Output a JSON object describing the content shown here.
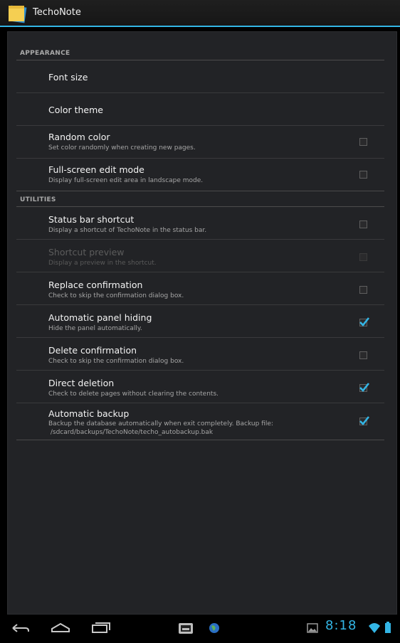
{
  "app": {
    "title": "TechoNote"
  },
  "sections": {
    "appearance": "APPEARANCE",
    "utilities": "UTILITIES"
  },
  "prefs": {
    "font_size": {
      "title": "Font size"
    },
    "color_theme": {
      "title": "Color theme"
    },
    "random_color": {
      "title": "Random color",
      "summary": "Set color randomly when creating new pages.",
      "checked": false
    },
    "fullscreen": {
      "title": "Full-screen edit mode",
      "summary": "Display full-screen edit area in landscape mode.",
      "checked": false
    },
    "status_bar_shortcut": {
      "title": "Status bar shortcut",
      "summary": "Display a shortcut of TechoNote in the status bar.",
      "checked": false
    },
    "shortcut_preview": {
      "title": "Shortcut preview",
      "summary": "Display a preview in the shortcut.",
      "checked": false,
      "enabled": false
    },
    "replace_confirmation": {
      "title": "Replace confirmation",
      "summary": "Check to skip the confirmation dialog box.",
      "checked": false
    },
    "auto_panel_hiding": {
      "title": "Automatic panel hiding",
      "summary": "Hide the panel automatically.",
      "checked": true
    },
    "delete_confirmation": {
      "title": "Delete confirmation",
      "summary": "Check to skip the confirmation dialog box.",
      "checked": false
    },
    "direct_deletion": {
      "title": "Direct deletion",
      "summary": "Check to delete pages without clearing the contents.",
      "checked": true
    },
    "auto_backup": {
      "title": "Automatic backup",
      "summary_line1": "Backup the database automatically when exit completely. Backup file:",
      "summary_line2": " /sdcard/backups/TechoNote/techo_autobackup.bak",
      "checked": true
    }
  },
  "status": {
    "time": "8:18"
  },
  "colors": {
    "accent": "#33b5e5",
    "background": "#222326"
  }
}
